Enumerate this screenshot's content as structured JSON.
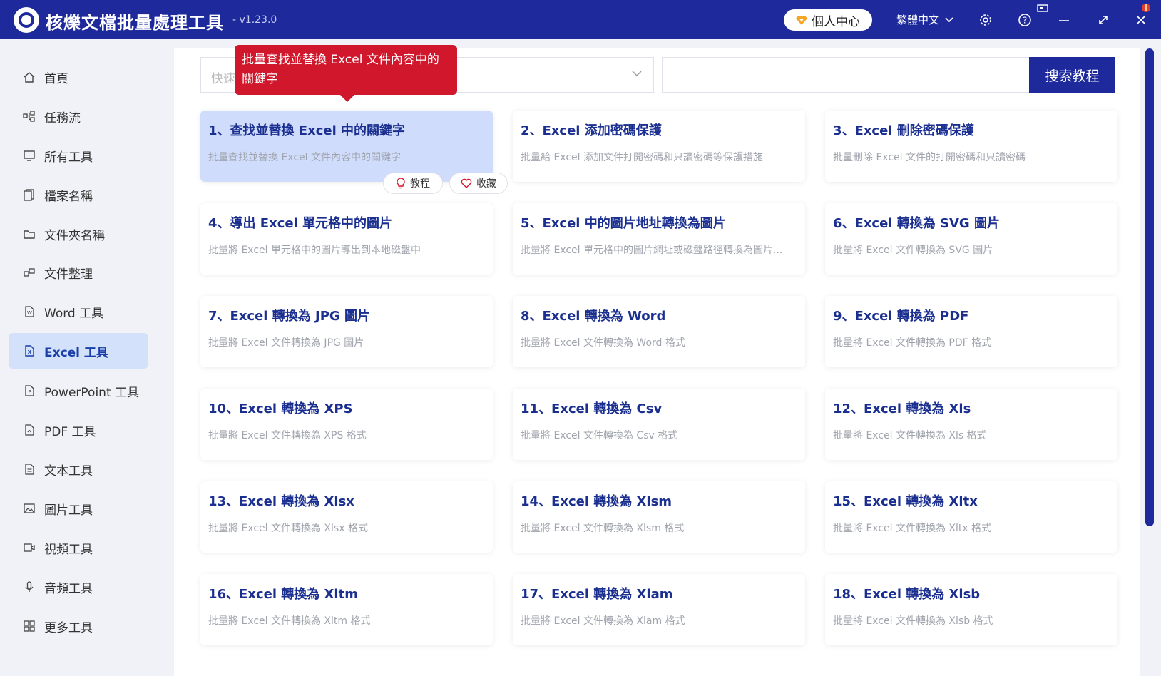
{
  "app": {
    "title": "核爍文檔批量處理工具",
    "version": "- v1.23.0",
    "user_center": "個人中心",
    "language": "繁體中文"
  },
  "sidebar": {
    "items": [
      {
        "label": "首頁",
        "icon": "home-icon"
      },
      {
        "label": "任務流",
        "icon": "workflow-icon"
      },
      {
        "label": "所有工具",
        "icon": "monitor-icon"
      },
      {
        "label": "檔案名稱",
        "icon": "file-copy-icon"
      },
      {
        "label": "文件夾名稱",
        "icon": "folder-icon"
      },
      {
        "label": "文件整理",
        "icon": "organize-icon"
      },
      {
        "label": "Word 工具",
        "icon": "word-file-icon"
      },
      {
        "label": "Excel 工具",
        "icon": "excel-file-icon",
        "active": true
      },
      {
        "label": "PowerPoint 工具",
        "icon": "ppt-file-icon"
      },
      {
        "label": "PDF 工具",
        "icon": "pdf-file-icon"
      },
      {
        "label": "文本工具",
        "icon": "text-file-icon"
      },
      {
        "label": "圖片工具",
        "icon": "image-icon"
      },
      {
        "label": "視頻工具",
        "icon": "video-icon"
      },
      {
        "label": "音頻工具",
        "icon": "microphone-icon"
      },
      {
        "label": "更多工具",
        "icon": "grid-icon"
      }
    ]
  },
  "search": {
    "placeholder": "快速",
    "button_label": "搜索教程"
  },
  "tooltip": {
    "text": "批量查找並替換 Excel 文件內容中的關鍵字"
  },
  "card_actions": {
    "tutorial": "教程",
    "favorite": "收藏"
  },
  "cards": [
    {
      "title": "1、查找並替換 Excel 中的關鍵字",
      "desc": "批量查找並替換 Excel 文件內容中的關鍵字"
    },
    {
      "title": "2、Excel 添加密碼保護",
      "desc": "批量給 Excel 添加文件打開密碼和只讀密碼等保護措施"
    },
    {
      "title": "3、Excel 刪除密碼保護",
      "desc": "批量刪除 Excel 文件的打開密碼和只讀密碼"
    },
    {
      "title": "4、導出 Excel 單元格中的圖片",
      "desc": "批量將 Excel 單元格中的圖片導出到本地磁盤中"
    },
    {
      "title": "5、Excel 中的圖片地址轉換為圖片",
      "desc": "批量將 Excel 單元格中的圖片網址或磁盤路徑轉換為圖片..."
    },
    {
      "title": "6、Excel 轉換為 SVG 圖片",
      "desc": "批量將 Excel 文件轉換為 SVG 圖片"
    },
    {
      "title": "7、Excel 轉換為 JPG 圖片",
      "desc": "批量將 Excel 文件轉換為 JPG 圖片"
    },
    {
      "title": "8、Excel 轉換為 Word",
      "desc": "批量將 Excel 文件轉換為 Word 格式"
    },
    {
      "title": "9、Excel 轉換為 PDF",
      "desc": "批量將 Excel 文件轉換為 PDF 格式"
    },
    {
      "title": "10、Excel 轉換為 XPS",
      "desc": "批量將 Excel 文件轉換為 XPS 格式"
    },
    {
      "title": "11、Excel 轉換為 Csv",
      "desc": "批量將 Excel 文件轉換為 Csv 格式"
    },
    {
      "title": "12、Excel 轉換為 Xls",
      "desc": "批量將 Excel 文件轉換為 Xls 格式"
    },
    {
      "title": "13、Excel 轉換為 Xlsx",
      "desc": "批量將 Excel 文件轉換為 Xlsx 格式"
    },
    {
      "title": "14、Excel 轉換為 Xlsm",
      "desc": "批量將 Excel 文件轉換為 Xlsm 格式"
    },
    {
      "title": "15、Excel 轉換為 Xltx",
      "desc": "批量將 Excel 文件轉換為 Xltx 格式"
    },
    {
      "title": "16、Excel 轉換為 Xltm",
      "desc": "批量將 Excel 文件轉換為 Xltm 格式"
    },
    {
      "title": "17、Excel 轉換為 Xlam",
      "desc": "批量將 Excel 文件轉換為 Xlam 格式"
    },
    {
      "title": "18、Excel 轉換為 Xlsb",
      "desc": "批量將 Excel 文件轉換為 Xlsb 格式"
    }
  ],
  "colors": {
    "brand": "#1e2a9c",
    "tooltip": "#d0172b",
    "active_bg": "#cfdcfb"
  }
}
